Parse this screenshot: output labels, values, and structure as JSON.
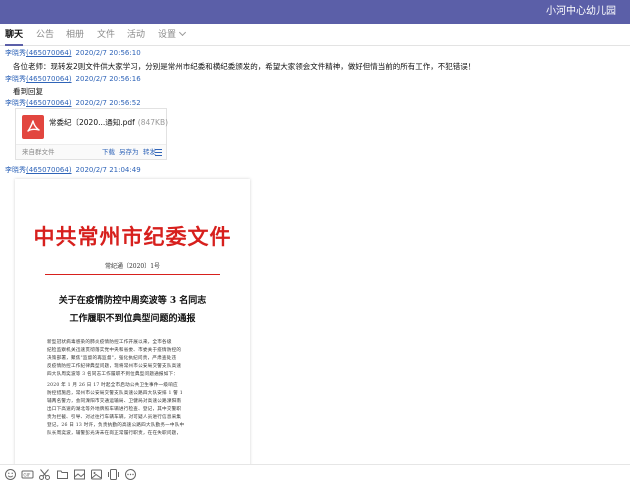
{
  "window": {
    "title": "小河中心幼儿园"
  },
  "tabs": [
    {
      "label": "聊天"
    },
    {
      "label": "公告"
    },
    {
      "label": "相册"
    },
    {
      "label": "文件"
    },
    {
      "label": "活动"
    },
    {
      "label": "设置"
    }
  ],
  "messages": [
    {
      "sender": "李晓秀",
      "sender_id": "(465070064)",
      "time": "2020/2/7 20:56:10",
      "text": "各位老师：现转发2则文件供大家学习，分别是常州市纪委和横纪委颁发的，希望大家领会文件精神，做好但情当前的所有工作，不犯错误！"
    },
    {
      "sender": "李晓秀",
      "sender_id": "(465070064)",
      "time": "2020/2/7 20:56:16",
      "text": "看到回复"
    },
    {
      "sender": "李晓秀",
      "sender_id": "(465070064)",
      "time": "2020/2/7 20:56:52",
      "file": {
        "name": "常委纪〔2020...通知.pdf",
        "size": "(847KB)",
        "source": "来自群文件",
        "actions": [
          "下载",
          "另存为",
          "转发"
        ]
      }
    },
    {
      "sender": "李晓秀",
      "sender_id": "(465070064)",
      "time": "2020/2/7 21:04:49"
    }
  ],
  "document": {
    "header": "中共常州市纪委文件",
    "number": "常纪通〔2020〕1号",
    "title_line1": "关于在疫情防控中周奕波等 3 名同志",
    "title_line2": "工作履职不到位典型问题的通报",
    "body": [
      "新型冠状病毒感染的肺炎疫情防控工作开展以来，全市各级",
      "纪检监察机关迅速贯彻落实党中央和省委、市委关于疫情防控的",
      "决策部署，聚焦\"监督的再监督\"，强化执纪问责，严肃查处违",
      "反疫情防控工作纪律典型问题，现将常州市公安局交警支队高速",
      "四大队周奕波等 3 名同志工作履职不到位典型问题通报如下：",
      "2020 年 1 月 26 日 17 时起全市启动公共卫生事件一级响应",
      "防控措施后，常州市公安局交警支队高速公路四大队安排 1 警 1",
      "辅两名警力，会同溧阳市交通运输局、卫健局对高速公路溧阳南",
      "出口下高速的湖北等外地牌照车辆进行检查、登记，其中交警职",
      "责为拦截、引导、对过往行车辆车辆，对可疑人员进行信息采集",
      "登记。26 日 13 时许，负责执勤的高速公路四大队勤务一中队中",
      "队长周奕波，辅警彭光涛未在岗正常履行职责，在在失职问题，"
    ]
  },
  "toolbar": {
    "icons": [
      "emoji-icon",
      "gif-icon",
      "scissors-icon",
      "folder-icon",
      "image-icon",
      "shake-icon",
      "voice-icon",
      "more-icon"
    ]
  }
}
